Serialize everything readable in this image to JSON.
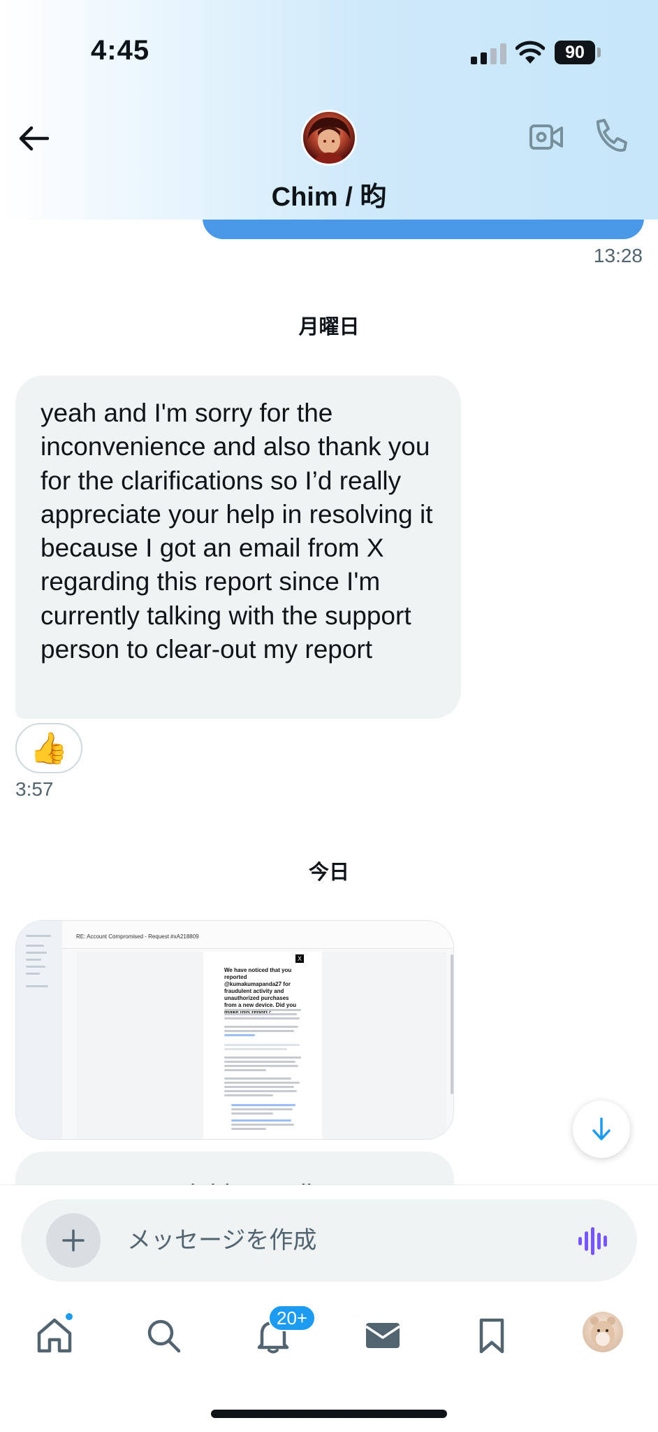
{
  "status_bar": {
    "time": "4:45",
    "battery": "90"
  },
  "header": {
    "contact_name": "Chim / 昀"
  },
  "conversation": {
    "prev_message_time": "13:28",
    "date_separator_1": "月曜日",
    "incoming_message": "yeah and I'm sorry for the inconvenience and also thank you for the clarifications so I’d really appreciate your help in resolving it because I got an email from X regarding this report since I'm currently talking with the support person to clear-out my report",
    "reaction_emoji": "👍",
    "incoming_time": "3:57",
    "date_separator_2": "今日",
    "attachment": {
      "subject": "RE: Account Compromised - Request #xA218809",
      "heading": "We have noticed that you reported @kumakumapanda27 for fraudulent activity and unauthorized purchases from a new device. Did you make this report?"
    },
    "partial_message": "Can you read this email"
  },
  "composer": {
    "placeholder": "メッセージを作成"
  },
  "tabbar": {
    "notification_badge": "20+"
  },
  "icons": {
    "back": "arrow-left-icon",
    "video": "video-camera-icon",
    "call": "phone-icon",
    "scroll_down": "arrow-down-icon",
    "add": "plus-icon",
    "voice": "voice-wave-icon",
    "home": "home-icon",
    "search": "search-icon",
    "notifications": "bell-icon",
    "messages": "envelope-icon",
    "bookmarks": "bookmark-icon"
  },
  "colors": {
    "accent": "#1d9bf0",
    "outgoing_bubble": "#4a99e9",
    "incoming_bubble": "#eff3f4",
    "voice": "#7856ff"
  }
}
